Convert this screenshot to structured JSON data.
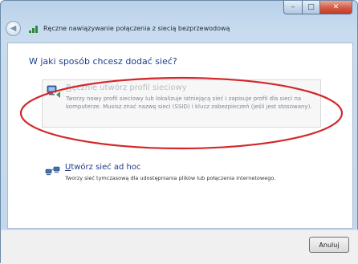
{
  "window": {
    "title": "Ręczne nawiązywanie połączenia z siecią bezprzewodową"
  },
  "caption_buttons": {
    "minimize_glyph": "–",
    "maximize_glyph": "□",
    "close_glyph": "✕"
  },
  "heading": "W jaki sposób chcesz dodać sieć?",
  "options": [
    {
      "title_accel": "R",
      "title_rest": "ęcznie utwórz profil sieciowy",
      "description": "Tworzy nowy profil sieciowy lub lokalizuje istniejącą sieć i zapisuje profil dla sieci na komputerze. Musisz znać nazwę sieci (SSID) i klucz zabezpieczeń (jeśli jest stosowany).",
      "icon": "network-profile-icon"
    },
    {
      "title_accel": "U",
      "title_rest": "twórz sieć ad hoc",
      "description": "Tworzy sieć tymczasową dla  udostępniania plików lub połączenia internetowego.",
      "icon": "adhoc-network-icon"
    }
  ],
  "footer": {
    "cancel_label": "Anuluj"
  },
  "colors": {
    "heading": "#1a3e91",
    "annotation_ellipse": "#d3272a",
    "frame": "#c3d7ec"
  }
}
